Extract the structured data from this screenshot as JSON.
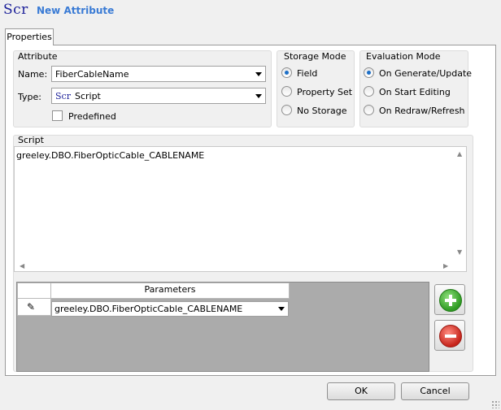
{
  "header": {
    "icon_text": "Scr",
    "title": "New Attribute"
  },
  "tabs": [
    {
      "label": "Properties"
    }
  ],
  "attribute": {
    "group_title": "Attribute",
    "name_label": "Name:",
    "name_value": "FiberCableName",
    "type_label": "Type:",
    "type_icon_text": "Scr",
    "type_value": "Script",
    "predefined_label": "Predefined",
    "predefined_checked": false
  },
  "storage_mode": {
    "group_title": "Storage Mode",
    "options": [
      {
        "label": "Field",
        "selected": true
      },
      {
        "label": "Property Set",
        "selected": false
      },
      {
        "label": "No Storage",
        "selected": false
      }
    ]
  },
  "evaluation_mode": {
    "group_title": "Evaluation Mode",
    "options": [
      {
        "label": "On Generate/Update",
        "selected": true
      },
      {
        "label": "On Start Editing",
        "selected": false
      },
      {
        "label": "On Redraw/Refresh",
        "selected": false
      }
    ]
  },
  "script": {
    "group_title": "Script",
    "text": "greeley.DBO.FiberOpticCable_CABLENAME"
  },
  "parameters": {
    "column_header": "Parameters",
    "rows": [
      {
        "value": "greeley.DBO.FiberOpticCable_CABLENAME"
      }
    ]
  },
  "footer": {
    "ok_label": "OK",
    "cancel_label": "Cancel"
  },
  "colors": {
    "title_blue": "#3a7bd5",
    "scr_navy": "#1b1f99",
    "add_green": "#2e9a22",
    "remove_red": "#c6231a"
  }
}
